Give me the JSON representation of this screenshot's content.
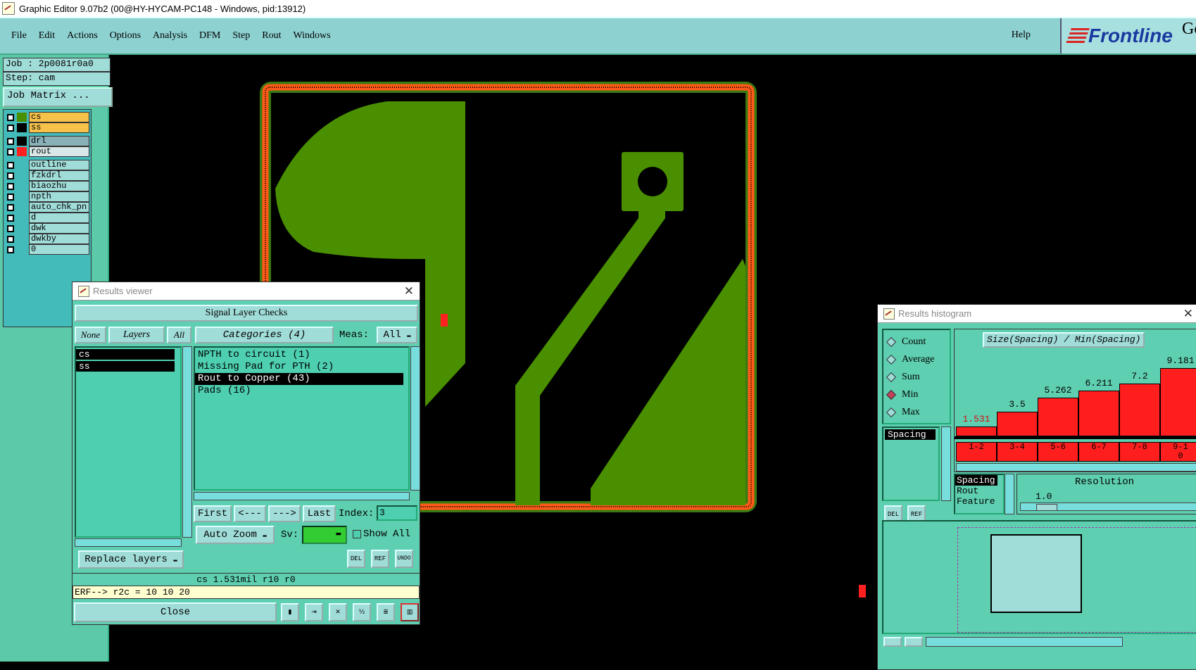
{
  "window": {
    "title": "Graphic Editor 9.07b2 (00@HY-HYCAM-PC148 - Windows, pid:13912)"
  },
  "menu": {
    "items": [
      "File",
      "Edit",
      "Actions",
      "Options",
      "Analysis",
      "DFM",
      "Step",
      "Rout",
      "Windows"
    ],
    "help": "Help",
    "logo": "Frontline",
    "logo_trailing": "Ge"
  },
  "job": {
    "job_label": "Job : 2p0081r0a0",
    "step_label": "Step: cam",
    "matrix_button": "Job Matrix ..."
  },
  "layers": [
    {
      "name": "cs",
      "swatch": "#4a8f00",
      "bg": "#f7c24a"
    },
    {
      "name": "ss",
      "swatch": "#000000",
      "bg": "#f7c24a"
    },
    {
      "name": "drl",
      "swatch": "#000000",
      "bg": "#8ab0b8"
    },
    {
      "name": "rout",
      "swatch": "#ff2020",
      "bg": "#d8e8e8"
    },
    {
      "name": "outline",
      "swatch": "",
      "bg": "#a0dcd8"
    },
    {
      "name": "fzkdrl",
      "swatch": "",
      "bg": "#a0dcd8"
    },
    {
      "name": "biaozhu",
      "swatch": "",
      "bg": "#a0dcd8"
    },
    {
      "name": "npth",
      "swatch": "",
      "bg": "#a0dcd8"
    },
    {
      "name": "auto_chk_pn",
      "swatch": "",
      "bg": "#a0dcd8"
    },
    {
      "name": "d",
      "swatch": "",
      "bg": "#a0dcd8"
    },
    {
      "name": "dwk",
      "swatch": "",
      "bg": "#a0dcd8"
    },
    {
      "name": "dwkby",
      "swatch": "",
      "bg": "#a0dcd8"
    },
    {
      "name": "0",
      "swatch": "",
      "bg": "#a0dcd8"
    }
  ],
  "results_viewer": {
    "title": "Results viewer",
    "heading": "Signal Layer Checks",
    "none": "None",
    "layers": "Layers",
    "all": "All",
    "categories": "Categories (4)",
    "meas_label": "Meas:",
    "meas_value": "All",
    "layer_list": [
      "cs",
      "ss"
    ],
    "category_list": [
      "NPTH to circuit (1)",
      "Missing Pad for PTH (2)",
      "Rout to Copper (43)",
      "Pads (16)"
    ],
    "nav": {
      "first": "First",
      "prev": "<---",
      "next": "--->",
      "last": "Last",
      "index_label": "Index:",
      "index_value": "3"
    },
    "auto_zoom": "Auto Zoom",
    "sv_label": "Sv:",
    "show_all": "Show All",
    "replace_layers": "Replace layers",
    "tools": {
      "del": "DEL",
      "ref": "REF",
      "undo": "UNDO"
    },
    "status": "cs 1.531mil  r10  r0",
    "erf": "ERF--> r2c = 10 10 20",
    "close": "Close"
  },
  "histogram": {
    "title": "Results histogram",
    "modes": [
      "Count",
      "Average",
      "Sum",
      "Min",
      "Max"
    ],
    "selected_mode": "Min",
    "header": "Size(Spacing) / Min(Spacing)",
    "list": [
      "Spacing"
    ],
    "bars": [
      {
        "range": "1-2",
        "value": "1.531",
        "level": 0.14
      },
      {
        "range": "3-4",
        "value": "3.5",
        "level": 0.36
      },
      {
        "range": "5-6",
        "value": "5.262",
        "level": 0.56
      },
      {
        "range": "6-7",
        "value": "6.211",
        "level": 0.66
      },
      {
        "range": "7-8",
        "value": "7.2",
        "level": 0.77
      },
      {
        "range": "9-10",
        "value": "9.181",
        "level": 0.99
      }
    ],
    "param_list": [
      "Spacing",
      "Rout",
      "Feature"
    ],
    "resolution_label": "Resolution",
    "resolution_value": "1.0",
    "del": "DEL",
    "ref": "REF"
  }
}
